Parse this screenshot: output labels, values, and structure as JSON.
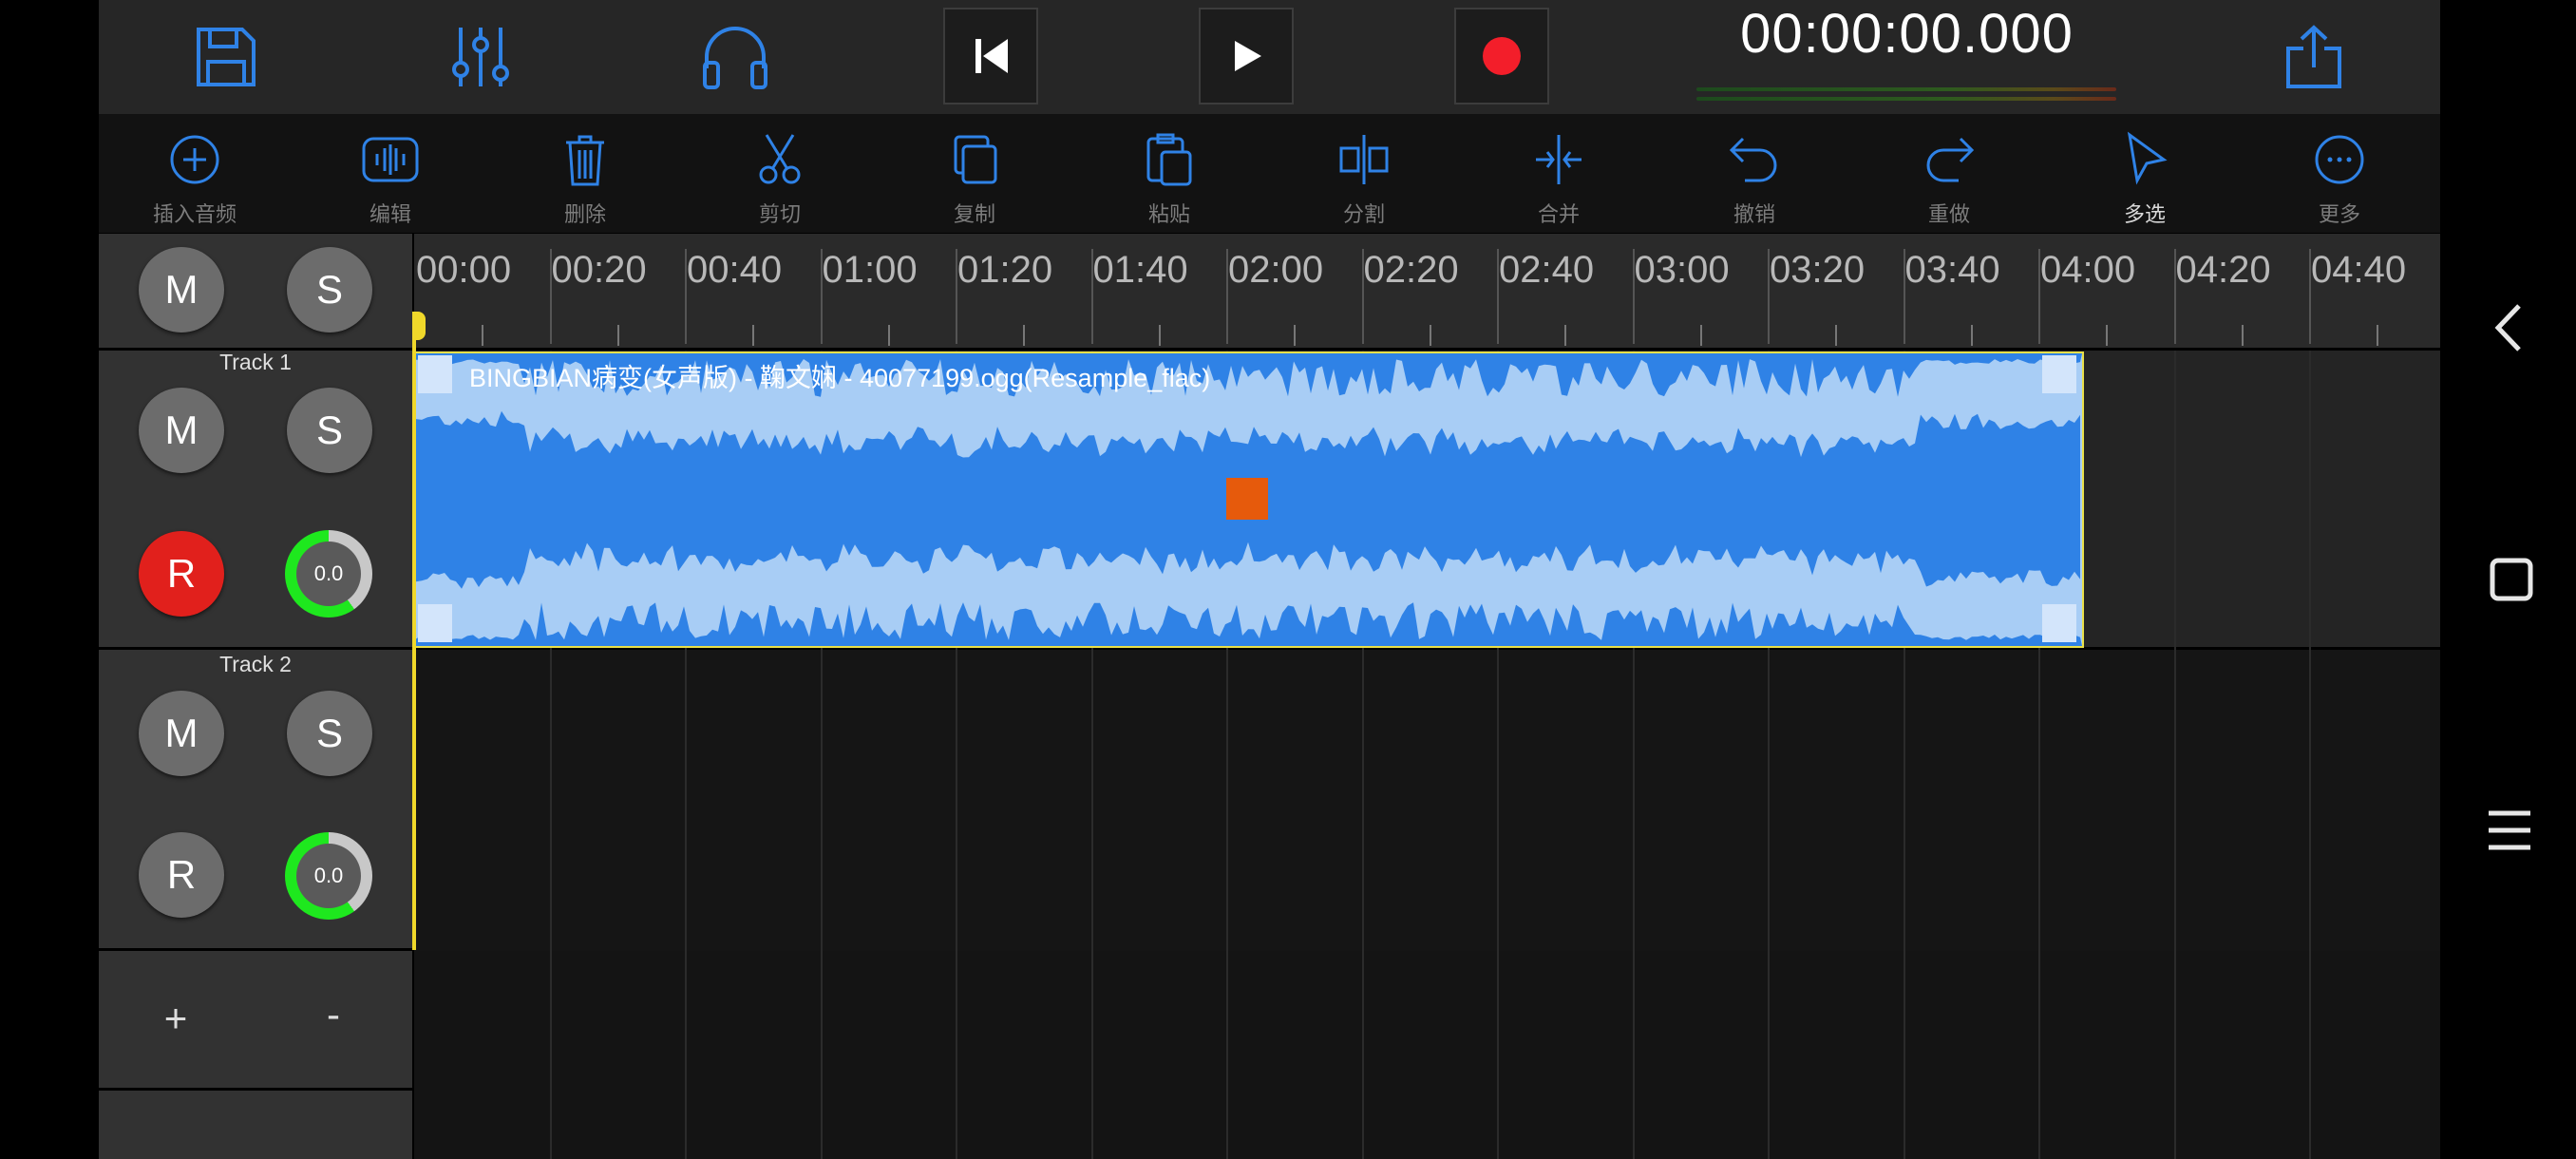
{
  "transport": {
    "time": "00:00:00.000"
  },
  "toolbar": [
    {
      "id": "insert-audio",
      "label": "插入音频",
      "icon": "plus-circle-icon"
    },
    {
      "id": "edit",
      "label": "编辑",
      "icon": "waveform-edit-icon"
    },
    {
      "id": "delete",
      "label": "删除",
      "icon": "trash-icon"
    },
    {
      "id": "cut",
      "label": "剪切",
      "icon": "scissors-icon"
    },
    {
      "id": "copy",
      "label": "复制",
      "icon": "copy-icon"
    },
    {
      "id": "paste",
      "label": "粘贴",
      "icon": "paste-icon"
    },
    {
      "id": "split",
      "label": "分割",
      "icon": "split-icon"
    },
    {
      "id": "merge",
      "label": "合并",
      "icon": "merge-icon"
    },
    {
      "id": "undo",
      "label": "撤销",
      "icon": "undo-icon"
    },
    {
      "id": "redo",
      "label": "重做",
      "icon": "redo-icon"
    },
    {
      "id": "multi-select",
      "label": "多选",
      "icon": "pointer-icon",
      "active": true
    },
    {
      "id": "more",
      "label": "更多",
      "icon": "more-icon"
    }
  ],
  "master": {
    "mute": "M",
    "solo": "S"
  },
  "tracks": [
    {
      "name": "Track 1",
      "mute": "M",
      "solo": "S",
      "record": "R",
      "record_armed": true,
      "volume": "0.0"
    },
    {
      "name": "Track 2",
      "mute": "M",
      "solo": "S",
      "record": "R",
      "record_armed": false,
      "volume": "0.0"
    }
  ],
  "track_controls": {
    "add": "+",
    "remove": "-"
  },
  "timeline": {
    "labels": [
      "00:00",
      "00:20",
      "00:40",
      "01:00",
      "01:20",
      "01:40",
      "02:00",
      "02:20",
      "02:40",
      "03:00",
      "03:20",
      "03:40",
      "04:00",
      "04:20",
      "04:40"
    ]
  },
  "clip": {
    "title": "BINGBIAN病变(女声版) - 鞠文娴 - 40077199.ogg(Resample_flac)",
    "end_time": "04:03"
  },
  "colors": {
    "accent": "#2f82e6",
    "record": "#e1201c",
    "clip_fill": "#a8cdf5",
    "waveform": "#2f82e6",
    "selection": "#e8e04a",
    "playhead": "#f0d82a",
    "knob_ring": "#1ee81e"
  }
}
